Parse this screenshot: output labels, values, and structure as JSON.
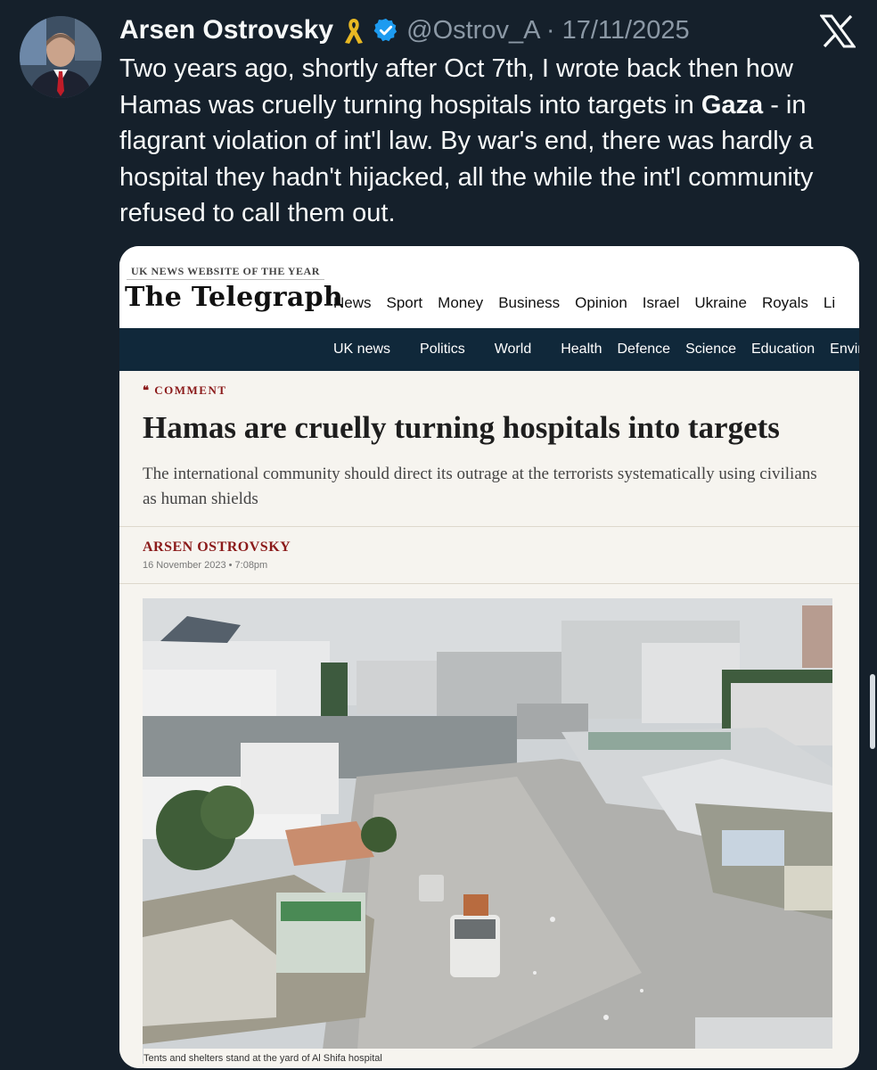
{
  "tweet": {
    "author_name": "Arsen Ostrovsky",
    "handle_date": "@Ostrov_A · 17/11/2025",
    "text_part1": "Two years ago, shortly after Oct 7th, I wrote back then how Hamas was cruelly turning hospitals into targets in ",
    "text_bold": "Gaza",
    "text_part2": " - in flagrant violation of int'l law. By war's end, there was hardly a hospital they hadn't hijacked, all the while the int'l community refused to call them out."
  },
  "article_card": {
    "award_label": "UK NEWS WEBSITE OF THE YEAR",
    "logo_text": "The Telegraph",
    "top_nav": [
      "News",
      "Sport",
      "Money",
      "Business",
      "Opinion",
      "Israel",
      "Ukraine",
      "Royals",
      "Li"
    ],
    "sub_nav": [
      "UK news",
      "Politics",
      "World",
      "Health",
      "Defence",
      "Science",
      "Education",
      "Envir"
    ],
    "kicker": "❝ COMMENT",
    "headline": "Hamas are cruelly turning hospitals into targets",
    "standfirst": "The international community should direct its outrage at the terrorists systematically using civilians as human shields",
    "byline": "ARSEN OSTROVSKY",
    "date": "16 November 2023 • 7:08pm",
    "photo_caption": "Tents and shelters stand at the yard of Al Shifa hospital"
  },
  "colors": {
    "background": "#15202b",
    "text": "#f7f9f9",
    "muted": "#8b98a5",
    "verified": "#1d9bf0",
    "ribbon": "#e8b823",
    "telegraph_nav": "#10283a",
    "telegraph_accent": "#8b1a1a"
  },
  "icons": {
    "ribbon": "yellow-ribbon-icon",
    "verified": "verified-badge-icon",
    "x_logo": "x-logo-icon"
  }
}
